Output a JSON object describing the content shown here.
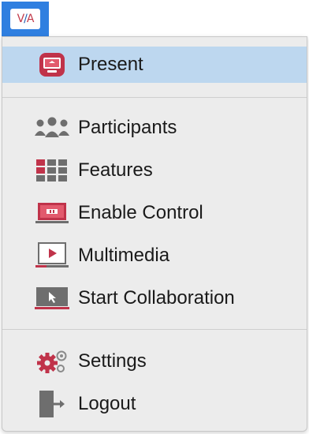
{
  "menubar": {
    "app_icon": "via-logo-icon",
    "logo_text": {
      "v": "V",
      "sep": "/",
      "a": "A"
    }
  },
  "menu": {
    "items": [
      {
        "label": "Present",
        "icon": "present-screen-icon",
        "highlighted": true
      },
      {
        "label": "Participants",
        "icon": "participants-icon",
        "highlighted": false
      },
      {
        "label": "Features",
        "icon": "features-grid-icon",
        "highlighted": false
      },
      {
        "label": "Enable Control",
        "icon": "enable-control-icon",
        "highlighted": false
      },
      {
        "label": "Multimedia",
        "icon": "multimedia-play-icon",
        "highlighted": false
      },
      {
        "label": "Start Collaboration",
        "icon": "collaboration-cursor-icon",
        "highlighted": false
      },
      {
        "label": "Settings",
        "icon": "settings-gears-icon",
        "highlighted": false
      },
      {
        "label": "Logout",
        "icon": "logout-door-icon",
        "highlighted": false
      }
    ]
  },
  "colors": {
    "accent_red": "#c0334a",
    "highlight_blue": "#bdd7ef",
    "menubar_blue": "#2f7fe0",
    "icon_gray": "#6e6e6e"
  }
}
